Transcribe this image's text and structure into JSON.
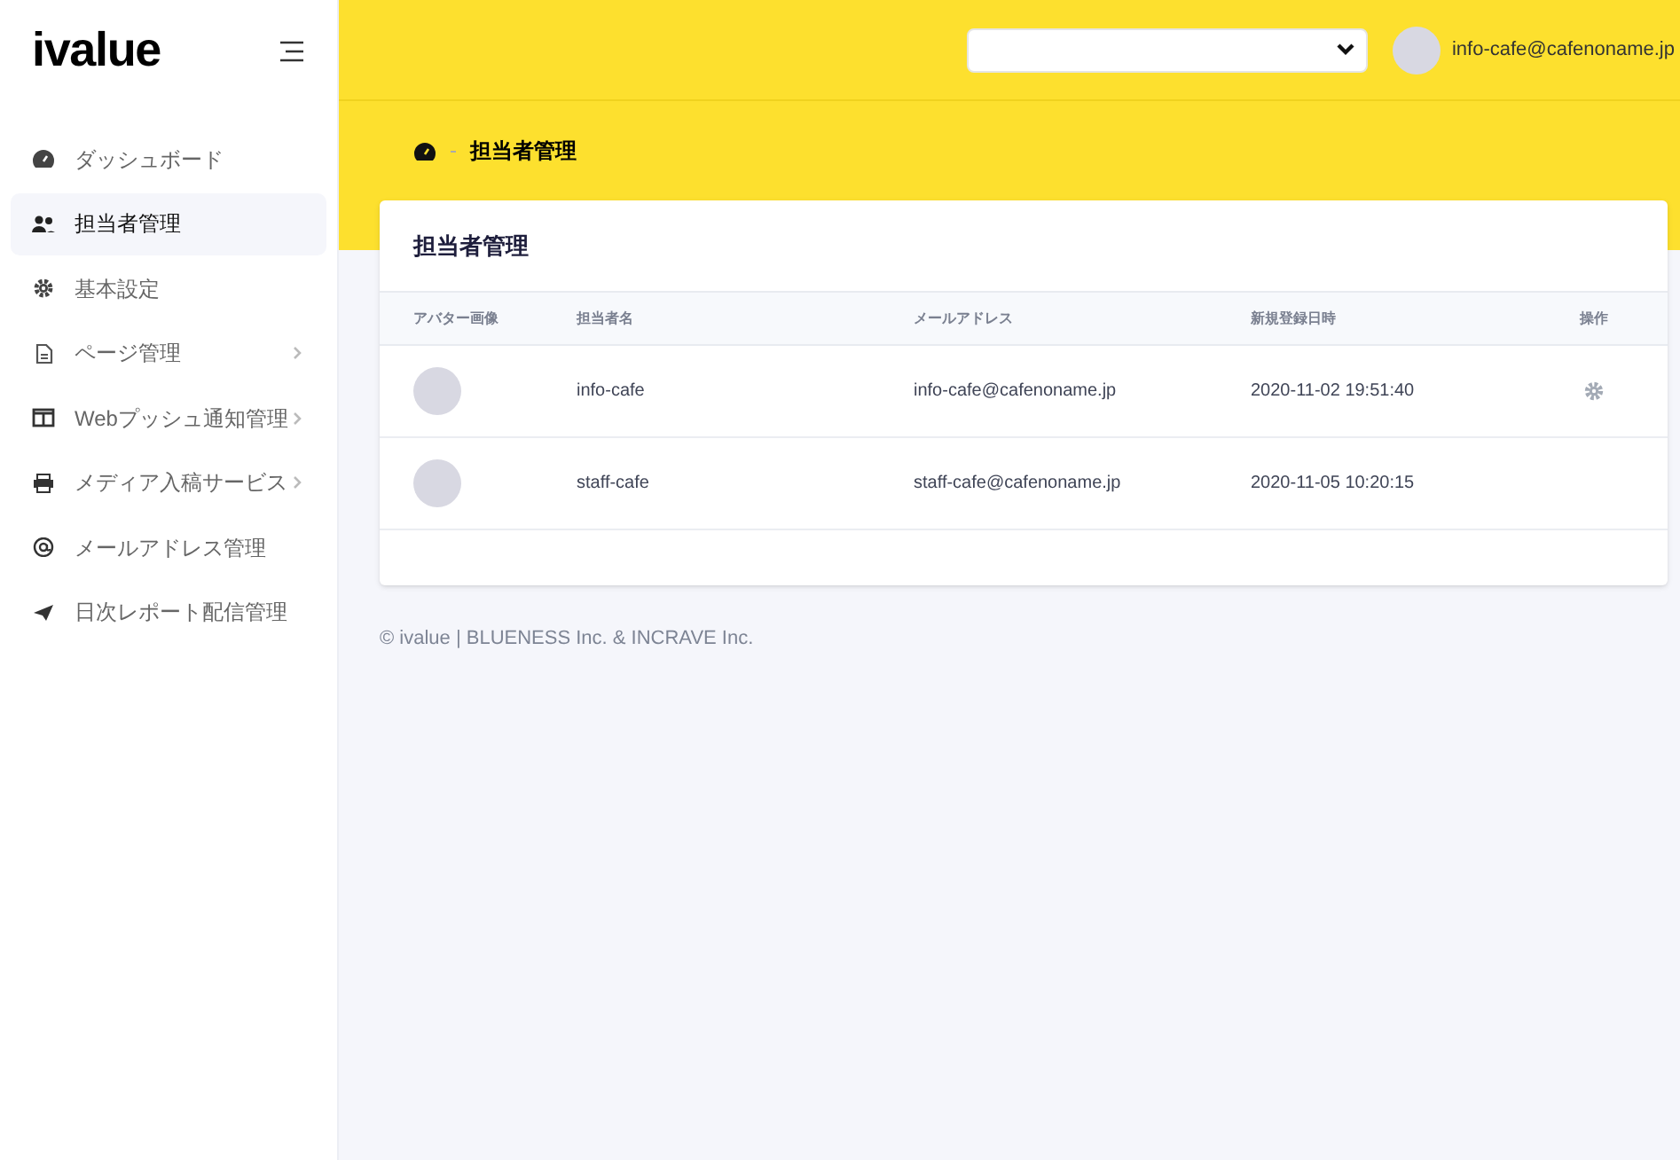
{
  "logo": "ivalue",
  "sidebar": {
    "items": [
      {
        "label": "ダッシュボード",
        "selected": false,
        "has_submenu": false
      },
      {
        "label": "担当者管理",
        "selected": true,
        "has_submenu": false
      },
      {
        "label": "基本設定",
        "selected": false,
        "has_submenu": false
      },
      {
        "label": "ページ管理",
        "selected": false,
        "has_submenu": true
      },
      {
        "label": "Webプッシュ通知管理",
        "selected": false,
        "has_submenu": true
      },
      {
        "label": "メディア入稿サービス",
        "selected": false,
        "has_submenu": true
      },
      {
        "label": "メールアドレス管理",
        "selected": false,
        "has_submenu": false
      },
      {
        "label": "日次レポート配信管理",
        "selected": false,
        "has_submenu": false
      }
    ]
  },
  "header": {
    "user": "info-cafe@cafenoname.jp"
  },
  "breadcrumb": {
    "current": "担当者管理"
  },
  "card": {
    "title": "担当者管理",
    "columns": [
      "アバター画像",
      "担当者名",
      "メールアドレス",
      "新規登録日時",
      "操作"
    ],
    "rows": [
      {
        "name": "info-cafe",
        "email": "info-cafe@cafenoname.jp",
        "created": "2020-11-02 19:51:40",
        "has_settings": true
      },
      {
        "name": "staff-cafe",
        "email": "staff-cafe@cafenoname.jp",
        "created": "2020-11-05 10:20:15",
        "has_settings": false
      }
    ]
  },
  "footer": "© ivalue | BLUENESS Inc. & INCRAVE Inc."
}
